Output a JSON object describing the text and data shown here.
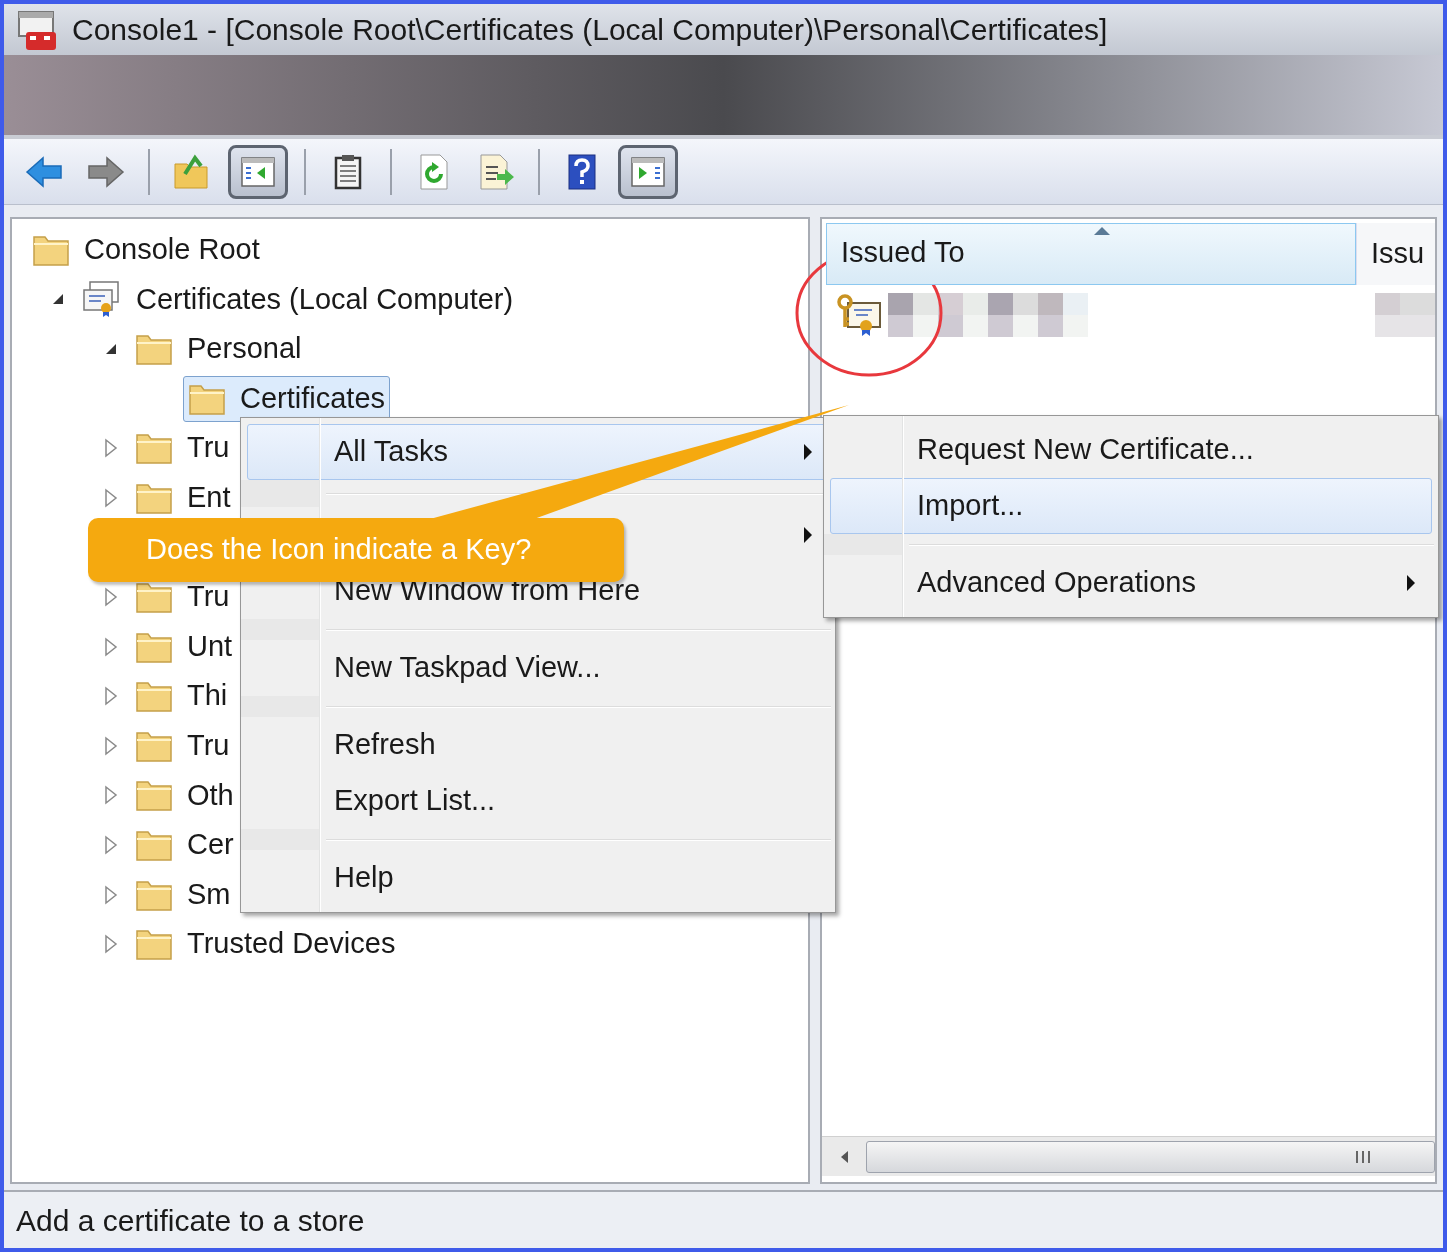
{
  "window": {
    "title": "Console1 - [Console Root\\Certificates (Local Computer)\\Personal\\Certificates]"
  },
  "toolbar": [
    {
      "kind": "back",
      "pressed": false
    },
    {
      "kind": "forward",
      "pressed": false
    },
    {
      "kind": "separator"
    },
    {
      "kind": "up",
      "pressed": false
    },
    {
      "kind": "tree-toggle",
      "pressed": true
    },
    {
      "kind": "separator"
    },
    {
      "kind": "properties",
      "pressed": false
    },
    {
      "kind": "separator"
    },
    {
      "kind": "refresh",
      "pressed": false
    },
    {
      "kind": "export",
      "pressed": false
    },
    {
      "kind": "separator"
    },
    {
      "kind": "help",
      "pressed": false
    },
    {
      "kind": "action-toggle",
      "pressed": true
    }
  ],
  "tree": [
    {
      "kind": "node",
      "label": "Console Root",
      "selected": false,
      "children": [
        {
          "kind": "node",
          "label": "Certificates (Local Computer)",
          "expanded": true,
          "selected": false,
          "children": [
            {
              "kind": "node",
              "label": "Personal",
              "expanded": true,
              "selected": false,
              "children": [
                {
                  "kind": "node",
                  "label": "Certificates",
                  "selected": true
                }
              ]
            },
            {
              "kind": "node",
              "label": "Tru",
              "expanded": false,
              "selected": false
            },
            {
              "kind": "node",
              "label": "Ent",
              "expanded": false,
              "selected": false
            },
            {
              "kind": "hidden"
            },
            {
              "kind": "node",
              "label": "Tru",
              "expanded": false,
              "selected": false
            },
            {
              "kind": "node",
              "label": "Unt",
              "expanded": false,
              "selected": false
            },
            {
              "kind": "node",
              "label": "Thi",
              "expanded": false,
              "selected": false
            },
            {
              "kind": "node",
              "label": "Tru",
              "expanded": false,
              "selected": false
            },
            {
              "kind": "node",
              "label": "Oth",
              "expanded": false,
              "selected": false
            },
            {
              "kind": "node",
              "label": "Cer",
              "expanded": false,
              "selected": false
            },
            {
              "kind": "node",
              "label": "Sm",
              "expanded": false,
              "selected": false
            },
            {
              "kind": "node",
              "label": "Trusted Devices",
              "expanded": false,
              "selected": false
            }
          ]
        }
      ]
    }
  ],
  "list": {
    "columns": [
      {
        "label": "Issued To",
        "sorted": true
      },
      {
        "label": "Issu",
        "sorted": false
      }
    ],
    "rows": [
      {
        "kind": "certificate"
      }
    ]
  },
  "context_menu": [
    {
      "kind": "item",
      "label": "All Tasks",
      "submenu": true,
      "selected": true
    },
    {
      "kind": "separator"
    },
    {
      "kind": "item",
      "submenu": true,
      "selected": false
    },
    {
      "kind": "item",
      "label": "New Window from Here",
      "submenu": false,
      "selected": false
    },
    {
      "kind": "separator"
    },
    {
      "kind": "item",
      "label": "New Taskpad View...",
      "submenu": false,
      "selected": false
    },
    {
      "kind": "separator"
    },
    {
      "kind": "item",
      "label": "Refresh",
      "submenu": false,
      "selected": false
    },
    {
      "kind": "item",
      "label": "Export List...",
      "submenu": false,
      "selected": false
    },
    {
      "kind": "separator"
    },
    {
      "kind": "item",
      "label": "Help",
      "submenu": false,
      "selected": false
    }
  ],
  "submenu": [
    {
      "kind": "item",
      "label": "Request New Certificate...",
      "submenu": false,
      "selected": false
    },
    {
      "kind": "item",
      "label": "Import...",
      "submenu": false,
      "selected": true
    },
    {
      "kind": "separator"
    },
    {
      "kind": "item",
      "label": "Advanced Operations",
      "submenu": true,
      "selected": false
    }
  ],
  "callout": {
    "text": "Does the Icon indicate a Key?"
  },
  "status_bar": {
    "text": "Add a certificate to a store"
  }
}
